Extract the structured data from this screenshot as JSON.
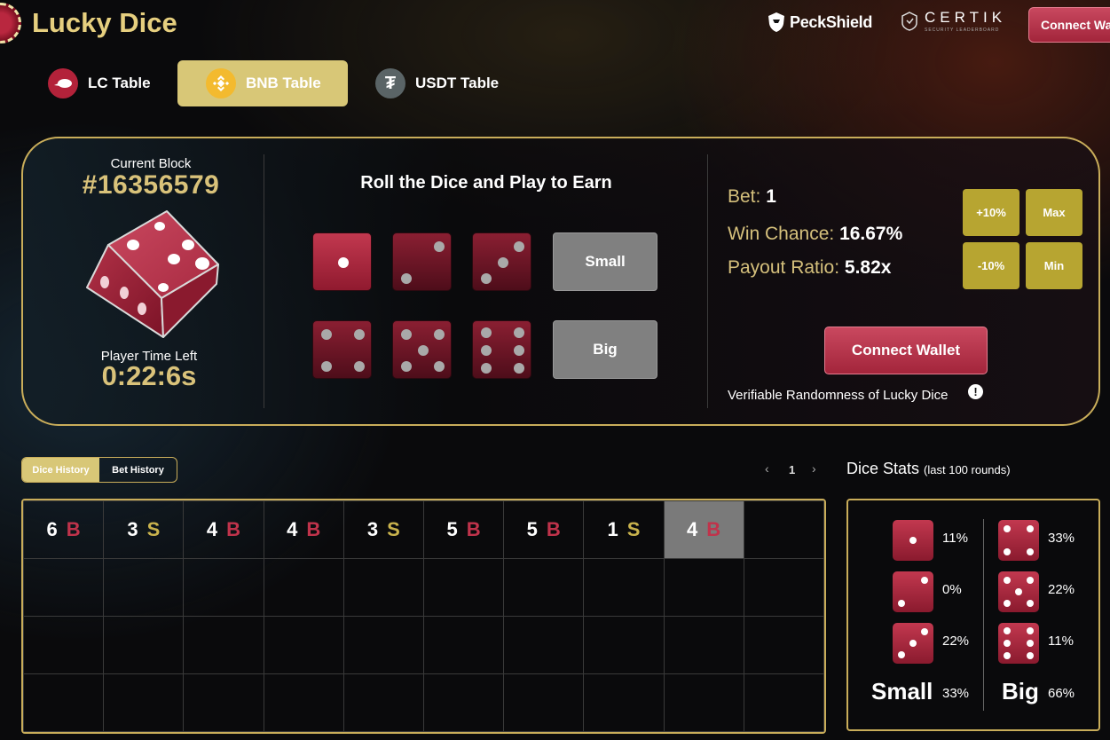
{
  "app": {
    "title": "Lucky Dice"
  },
  "partners": {
    "peckshield": "PeckShield",
    "certik": "CERTIK",
    "certik_sub": "SECURITY LEADERBOARD"
  },
  "header": {
    "connect_label": "Connect Wallet"
  },
  "tables": [
    {
      "label": "LC Table",
      "icon": "lc-token-icon"
    },
    {
      "label": "BNB Table",
      "icon": "bnb-token-icon",
      "active": true
    },
    {
      "label": "USDT Table",
      "icon": "usdt-token-icon",
      "glyph": "₮"
    }
  ],
  "game": {
    "current_block_label": "Current Block",
    "current_block": "#16356579",
    "time_left_label": "Player Time Left",
    "time_left": "0:22:6s",
    "roll_title": "Roll the Dice and Play to Earn",
    "faces": [
      1,
      2,
      3,
      4,
      5,
      6
    ],
    "selected_faces": [
      1
    ],
    "small_label": "Small",
    "big_label": "Big"
  },
  "bet": {
    "bet_label": "Bet:",
    "bet_value": "1",
    "win_label": "Win Chance:",
    "win_value": "16.67%",
    "payout_label": "Payout Ratio:",
    "payout_value": "5.82x",
    "plus10": "+10%",
    "max": "Max",
    "minus10": "-10%",
    "min": "Min",
    "connect_label": "Connect Wallet",
    "verifiable": "Verifiable Randomness of Lucky Dice",
    "info_glyph": "!"
  },
  "history": {
    "tabs": [
      {
        "label": "Dice History",
        "active": true
      },
      {
        "label": "Bet History"
      }
    ],
    "page": "1",
    "prev": "‹",
    "next": "›",
    "rounds": [
      {
        "n": "6",
        "r": "B"
      },
      {
        "n": "3",
        "r": "S"
      },
      {
        "n": "4",
        "r": "B"
      },
      {
        "n": "4",
        "r": "B"
      },
      {
        "n": "3",
        "r": "S"
      },
      {
        "n": "5",
        "r": "B"
      },
      {
        "n": "5",
        "r": "B"
      },
      {
        "n": "1",
        "r": "S"
      },
      {
        "n": "4",
        "r": "B"
      }
    ],
    "colors": {
      "B": "#c0334b",
      "S": "#c9b34d"
    }
  },
  "stats": {
    "title": "Dice Stats",
    "subtitle": "(last 100 rounds)",
    "small": [
      {
        "face": 1,
        "pct": "11%"
      },
      {
        "face": 2,
        "pct": "0%"
      },
      {
        "face": 3,
        "pct": "22%"
      }
    ],
    "big": [
      {
        "face": 4,
        "pct": "33%"
      },
      {
        "face": 5,
        "pct": "22%"
      },
      {
        "face": 6,
        "pct": "11%"
      }
    ],
    "small_label": "Small",
    "small_total": "33%",
    "big_label": "Big",
    "big_total": "66%"
  }
}
